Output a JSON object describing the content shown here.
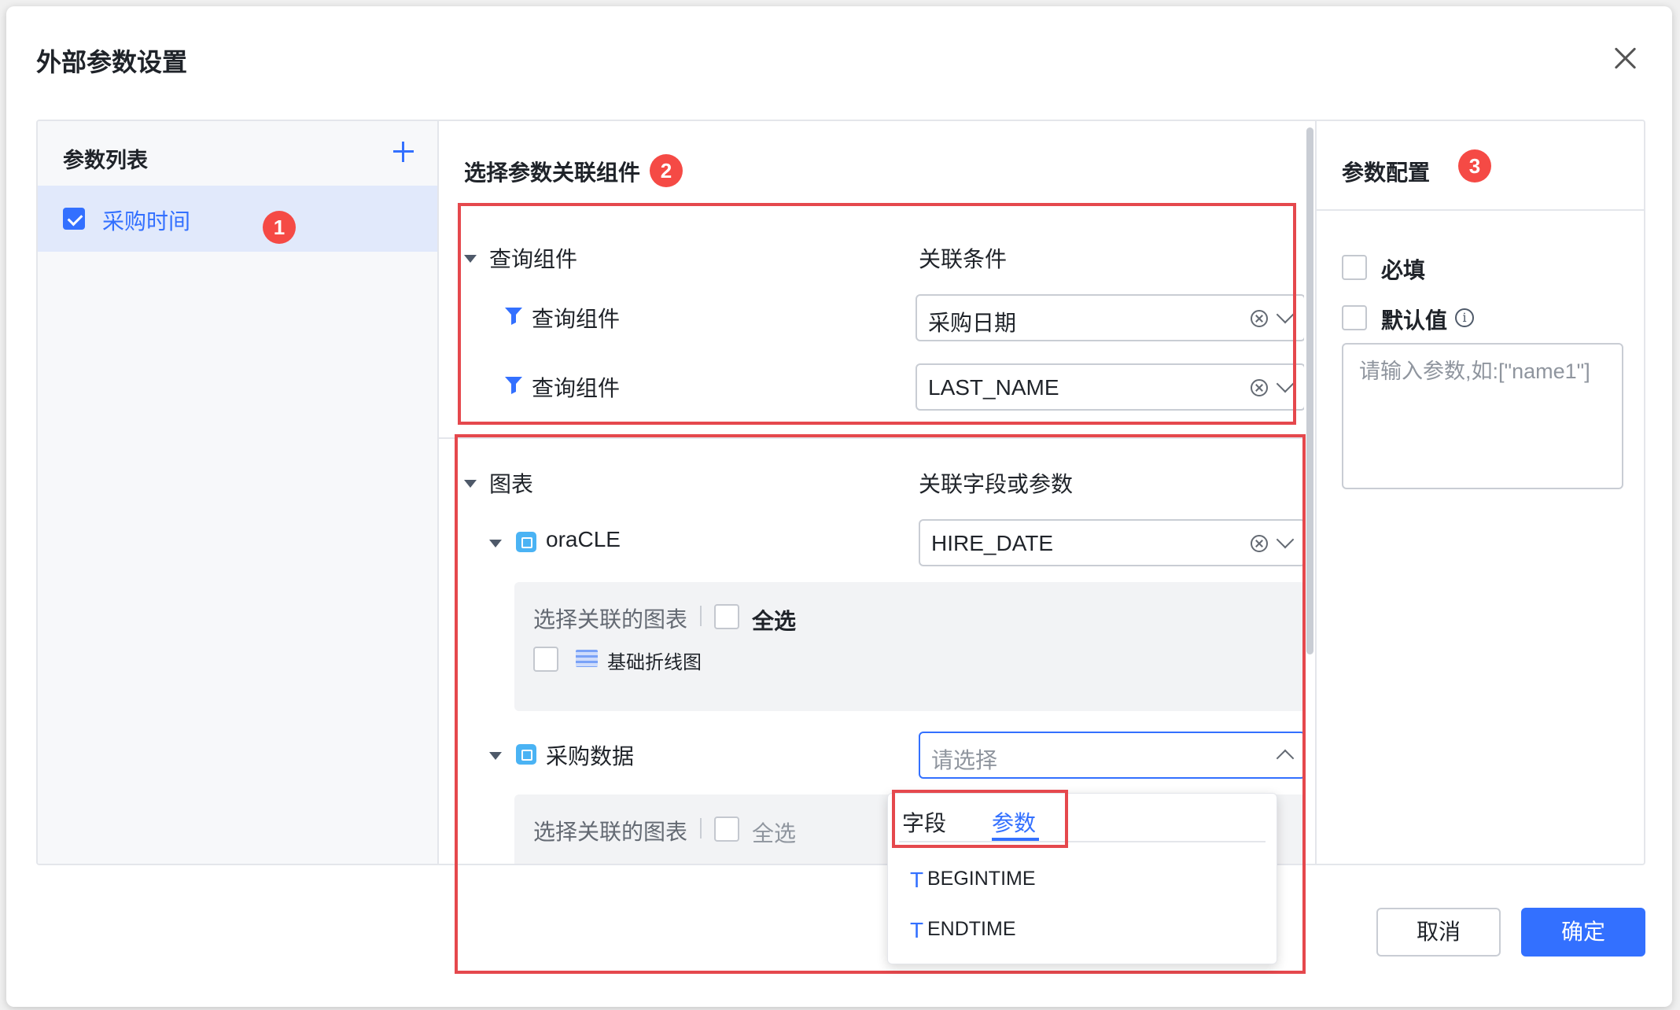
{
  "dialog": {
    "title": "外部参数设置"
  },
  "left": {
    "title": "参数列表",
    "items": [
      {
        "label": "采购时间",
        "checked": true
      }
    ]
  },
  "middle": {
    "title": "选择参数关联组件",
    "query_section": {
      "header": "查询组件",
      "condition_header": "关联条件",
      "rows": [
        {
          "label": "查询组件",
          "value": "采购日期"
        },
        {
          "label": "查询组件",
          "value": "LAST_NAME"
        }
      ]
    },
    "chart_section": {
      "header": "图表",
      "field_header": "关联字段或参数",
      "datasets": [
        {
          "name": "oraCLE",
          "value": "HIRE_DATE",
          "select_label": "选择关联的图表",
          "select_all": "全选",
          "charts": [
            "基础折线图"
          ]
        },
        {
          "name": "采购数据",
          "placeholder": "请选择",
          "select_label": "选择关联的图表",
          "select_all": "全选"
        }
      ]
    },
    "dropdown": {
      "tabs": [
        "字段",
        "参数"
      ],
      "active_tab": "参数",
      "options": [
        "BEGINTIME",
        "ENDTIME"
      ],
      "option_type_glyph": "T"
    }
  },
  "right": {
    "title": "参数配置",
    "required_label": "必填",
    "default_label": "默认值",
    "default_placeholder": "请输入参数,如:[\"name1\"]"
  },
  "badges": [
    "1",
    "2",
    "3"
  ],
  "footer": {
    "cancel": "取消",
    "ok": "确定"
  },
  "colors": {
    "accent": "#3370ff",
    "highlight": "#e5484d",
    "badge": "#f54a45"
  }
}
